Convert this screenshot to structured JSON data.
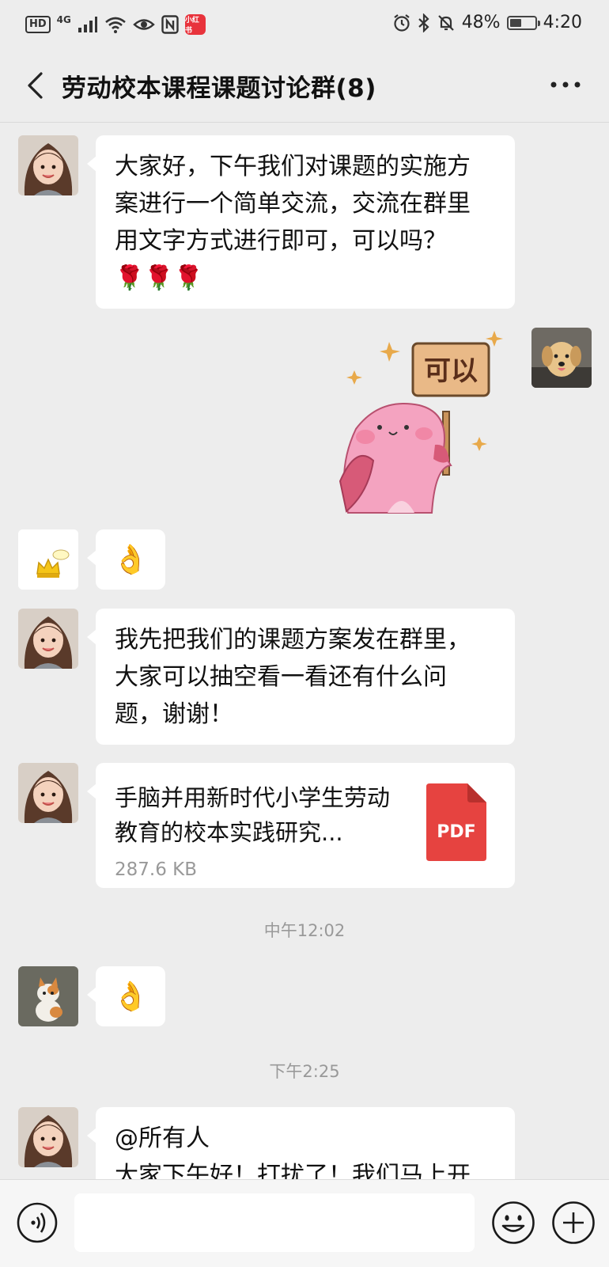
{
  "status_bar": {
    "hd": "HD",
    "network": "4G",
    "app_badge": "小红书",
    "battery": "48%",
    "battery_level": 0.48,
    "time": "4:20"
  },
  "header": {
    "title": "劳动校本课程课题讨论群(8)"
  },
  "messages": [
    {
      "sender": "girl",
      "type": "text",
      "text": "大家好，下午我们对课题的实施方\n案进行一个简单交流，交流在群里\n用文字方式进行即可，可以吗？\n🌹🌹🌹"
    },
    {
      "sender": "dog",
      "type": "sticker",
      "sticker_text": "可以"
    },
    {
      "sender": "crown",
      "type": "emoji",
      "text": "👌"
    },
    {
      "sender": "girl",
      "type": "text",
      "text": "我先把我们的课题方案发在群里，\n大家可以抽空看一看还有什么问\n题，谢谢！"
    },
    {
      "sender": "girl",
      "type": "file",
      "file_name": "手脑并用新时代小学生劳动教育的校本实践研究...",
      "file_size": "287.6 KB",
      "file_type": "PDF"
    },
    {
      "type": "timestamp",
      "text": "中午12:02"
    },
    {
      "sender": "cat",
      "type": "emoji",
      "text": "👌"
    },
    {
      "type": "timestamp",
      "text": "下午2:25"
    },
    {
      "sender": "girl",
      "type": "text",
      "text": "@所有人\n大家下午好！打扰了！我们马上开"
    }
  ],
  "input_bar": {
    "placeholder": ""
  },
  "colors": {
    "background": "#ededed",
    "bubble": "#ffffff",
    "pdf_red": "#e64340"
  },
  "icons": [
    "back-arrow-icon",
    "more-icon",
    "voice-icon",
    "emoji-icon",
    "plus-icon",
    "pdf-icon"
  ]
}
